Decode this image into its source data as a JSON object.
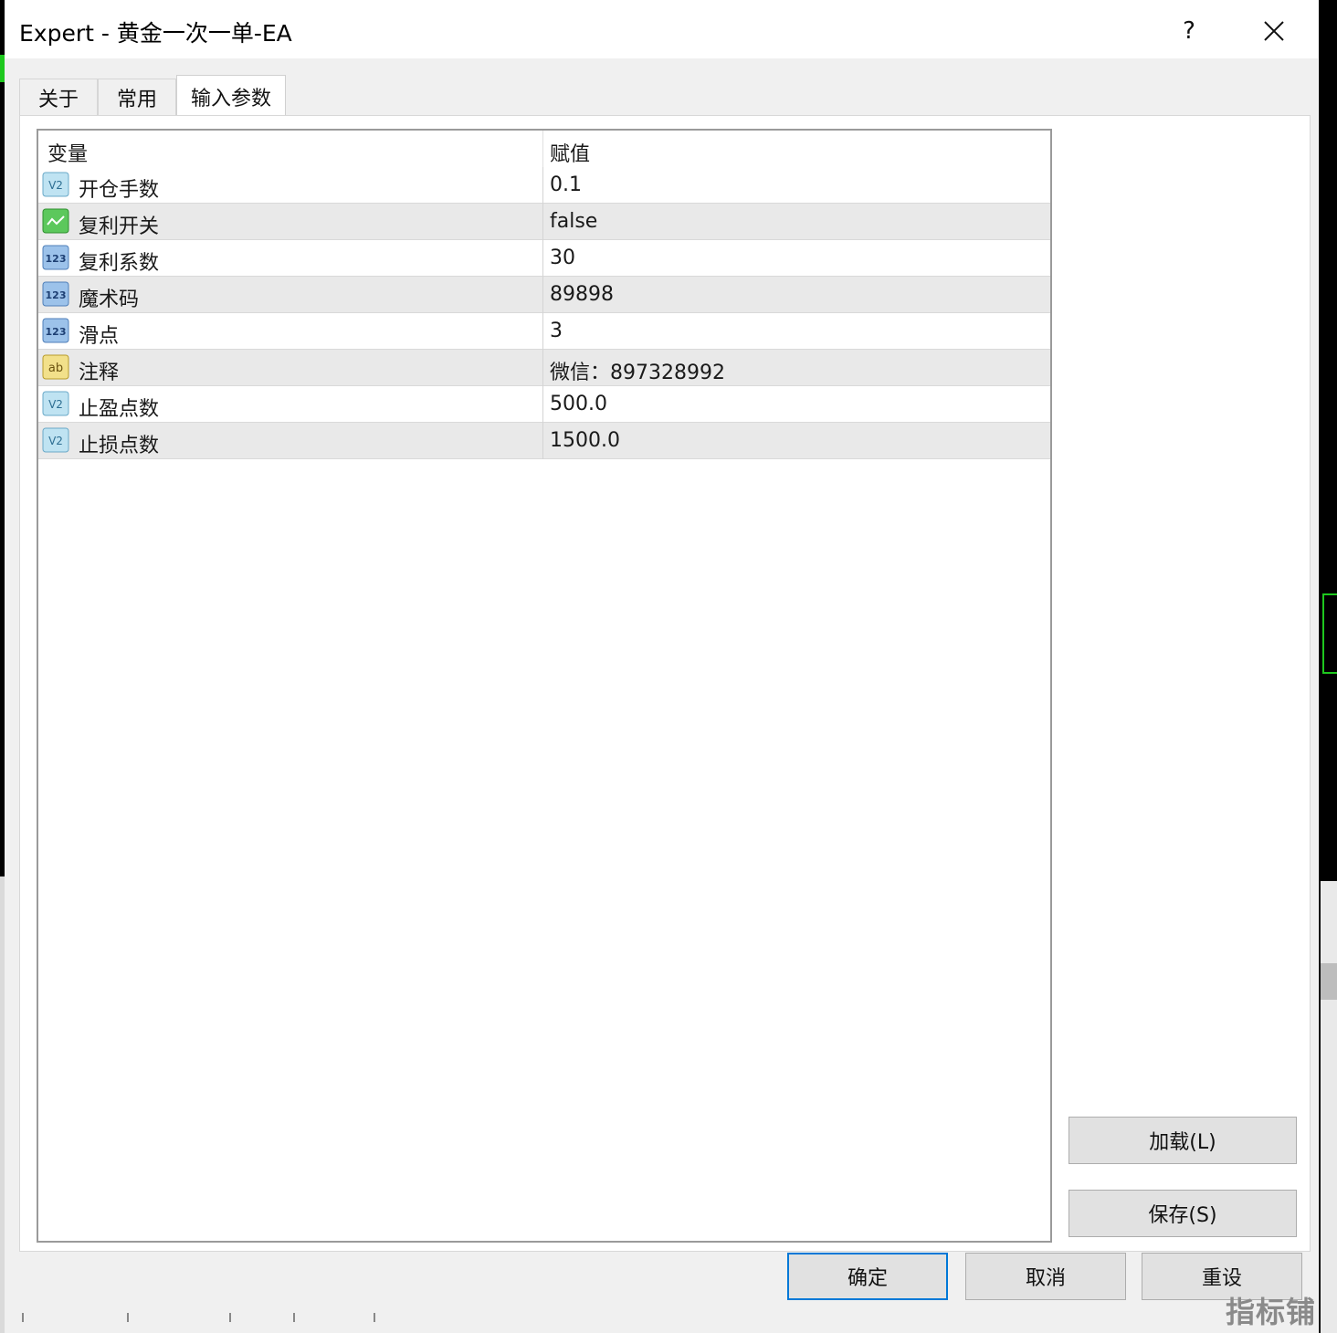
{
  "window": {
    "title": "Expert - 黄金一次一单-EA",
    "help_label": "?"
  },
  "tabs": [
    {
      "label": "关于",
      "active": false
    },
    {
      "label": "常用",
      "active": false
    },
    {
      "label": "输入参数",
      "active": true
    }
  ],
  "table": {
    "headers": {
      "variable": "变量",
      "value": "赋值"
    },
    "rows": [
      {
        "icon": "double-value-icon",
        "name": "开仓手数",
        "value": "0.1"
      },
      {
        "icon": "bool-toggle-icon",
        "name": "复利开关",
        "value": "false"
      },
      {
        "icon": "int-123-icon",
        "name": "复利系数",
        "value": "30"
      },
      {
        "icon": "int-123-icon",
        "name": "魔术码",
        "value": "89898"
      },
      {
        "icon": "int-123-icon",
        "name": "滑点",
        "value": "3"
      },
      {
        "icon": "string-ab-icon",
        "name": "注释",
        "value": "微信：897328992"
      },
      {
        "icon": "double-value-icon",
        "name": "止盈点数",
        "value": "500.0"
      },
      {
        "icon": "double-value-icon",
        "name": "止损点数",
        "value": "1500.0"
      }
    ]
  },
  "buttons": {
    "load": "加载(L)",
    "save": "保存(S)",
    "ok": "确定",
    "cancel": "取消",
    "reset": "重设"
  },
  "watermark": "指标铺",
  "colors": {
    "accent": "#0078d7",
    "dialog_bg": "#f0f0f0",
    "row_alt": "#e9e9e9"
  }
}
